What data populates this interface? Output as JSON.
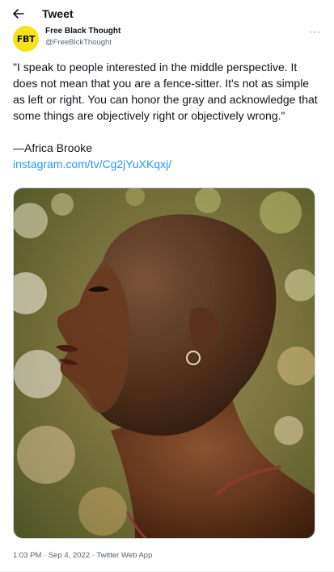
{
  "header": {
    "title": "Tweet",
    "back_icon": "arrow-left-icon"
  },
  "author": {
    "avatar_text": "FBT",
    "avatar_color": "#f5e21b",
    "display_name": "Free Black Thought",
    "handle": "@FreeBlckThought"
  },
  "more_icon": "more-horizontal-icon",
  "more_label": "···",
  "tweet": {
    "quote": "\"I speak to people interested in the middle perspective. It does not mean that you are a fence-sitter. It's not as simple as left or right. You can honor the gray and acknowledge that some things are objectively right or objectively wrong.\"",
    "attribution": "—Africa Brooke",
    "link": "instagram.com/tv/Cg2jYuXKqxj/",
    "link_color": "#1d9bf0"
  },
  "meta": {
    "time": "1:03 PM",
    "date": "Sep 4, 2022",
    "client": "Twitter Web App",
    "separator": " · "
  }
}
